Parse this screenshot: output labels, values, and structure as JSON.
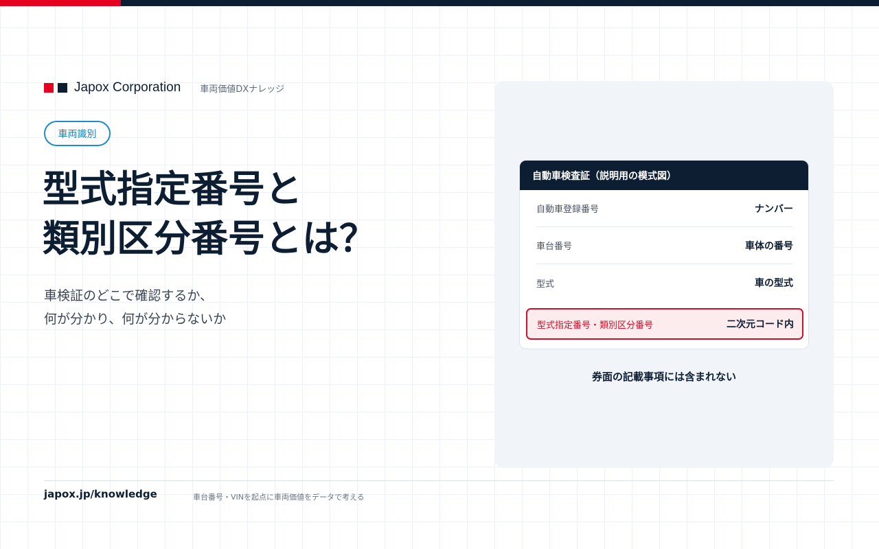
{
  "brand": {
    "name": "Japox Corporation",
    "subtitle": "車両価値DXナレッジ",
    "colors": {
      "red": "#e60020",
      "navy": "#0d1e33"
    }
  },
  "tag": {
    "label": "車両識別",
    "color": "#1f8bc9"
  },
  "headline": {
    "line1": "型式指定番号と",
    "line2": "類別区分番号とは？"
  },
  "subtitle": {
    "line1": "車検証のどこで確認するか、",
    "line2": "何が分かり、何が分からないか"
  },
  "card": {
    "header": "自動車検査証（説明用の模式図）",
    "rows": [
      {
        "label": "自動車登録番号",
        "value": "ナンバー"
      },
      {
        "label": "車台番号",
        "value": "車体の番号"
      },
      {
        "label": "型式",
        "value": "車の型式"
      }
    ],
    "highlight": {
      "label": "型式指定番号・類別区分番号",
      "value": "二次元コード内",
      "color": "#d0102a"
    },
    "note": "券面の記載事項には含まれない"
  },
  "footer": {
    "url": "japox.jp/knowledge",
    "tagline": "車台番号・VINを起点に車両価値をデータで考える"
  }
}
